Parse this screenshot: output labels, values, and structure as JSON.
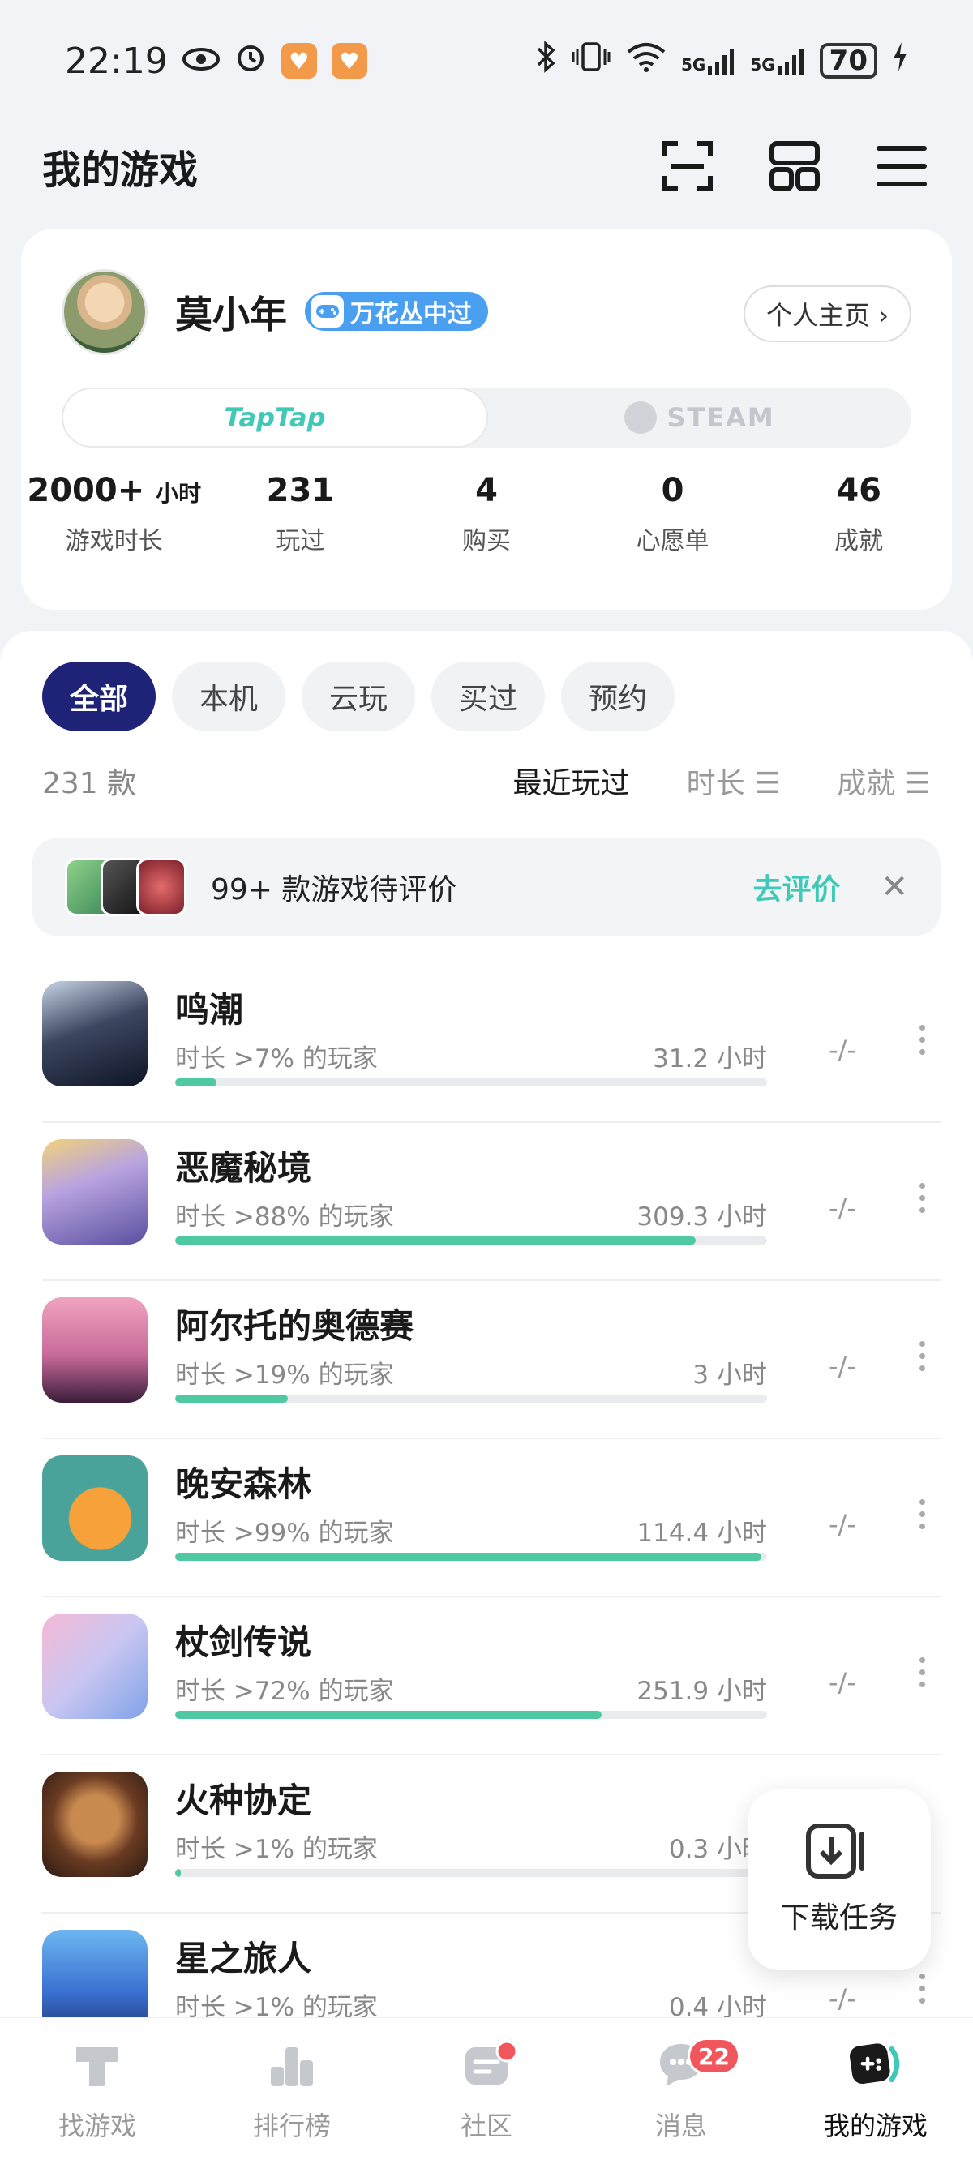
{
  "status_bar": {
    "time": "22:19",
    "battery": "70",
    "network_1": "5G",
    "network_2": "5G"
  },
  "header": {
    "title": "我的游戏"
  },
  "profile": {
    "username": "莫小年",
    "badge": "万花丛中过",
    "profile_link": "个人主页 ›",
    "platforms": [
      "TapTap",
      "STEAM"
    ],
    "stats": [
      {
        "value": "2000+",
        "unit": "小时",
        "label": "游戏时长"
      },
      {
        "value": "231",
        "unit": "",
        "label": "玩过"
      },
      {
        "value": "4",
        "unit": "",
        "label": "购买"
      },
      {
        "value": "0",
        "unit": "",
        "label": "心愿单"
      },
      {
        "value": "46",
        "unit": "",
        "label": "成就"
      }
    ]
  },
  "filters": {
    "tabs": [
      "全部",
      "本机",
      "云玩",
      "买过",
      "预约"
    ],
    "active": "全部"
  },
  "sort": {
    "count": "231 款",
    "options": [
      "最近玩过",
      "时长 ☰",
      "成就 ☰"
    ],
    "active": "最近玩过"
  },
  "review_banner": {
    "text": "99+ 款游戏待评价",
    "action": "去评价",
    "close": "✕"
  },
  "games": [
    {
      "name": "鸣潮",
      "rank": "时长 >7% 的玩家",
      "hours": "31.2 小时",
      "progress": 0.07,
      "achievement": "-/-"
    },
    {
      "name": "恶魔秘境",
      "rank": "时长 >88% 的玩家",
      "hours": "309.3 小时",
      "progress": 0.88,
      "achievement": "-/-"
    },
    {
      "name": "阿尔托的奥德赛",
      "rank": "时长 >19% 的玩家",
      "hours": "3 小时",
      "progress": 0.19,
      "achievement": "-/-"
    },
    {
      "name": "晚安森林",
      "rank": "时长 >99% 的玩家",
      "hours": "114.4 小时",
      "progress": 0.99,
      "achievement": "-/-"
    },
    {
      "name": "杖剑传说",
      "rank": "时长 >72% 的玩家",
      "hours": "251.9 小时",
      "progress": 0.72,
      "achievement": "-/-"
    },
    {
      "name": "火种协定",
      "rank": "时长 >1% 的玩家",
      "hours": "0.3 小时",
      "progress": 0.01,
      "achievement": ""
    },
    {
      "name": "星之旅人",
      "rank": "时长 >1% 的玩家",
      "hours": "0.4 小时",
      "progress": 0.01,
      "achievement": "-/-"
    }
  ],
  "download_fab": {
    "label": "下载任务"
  },
  "bottom_nav": {
    "items": [
      "找游戏",
      "排行榜",
      "社区",
      "消息",
      "我的游戏"
    ],
    "active": "我的游戏",
    "message_badge": "22"
  },
  "colors": {
    "accent": "#3fc9b6",
    "active_chip": "#1f2378",
    "progress": "#4fc9a2",
    "badge": "#4a9ff0",
    "notification": "#f0565b"
  }
}
